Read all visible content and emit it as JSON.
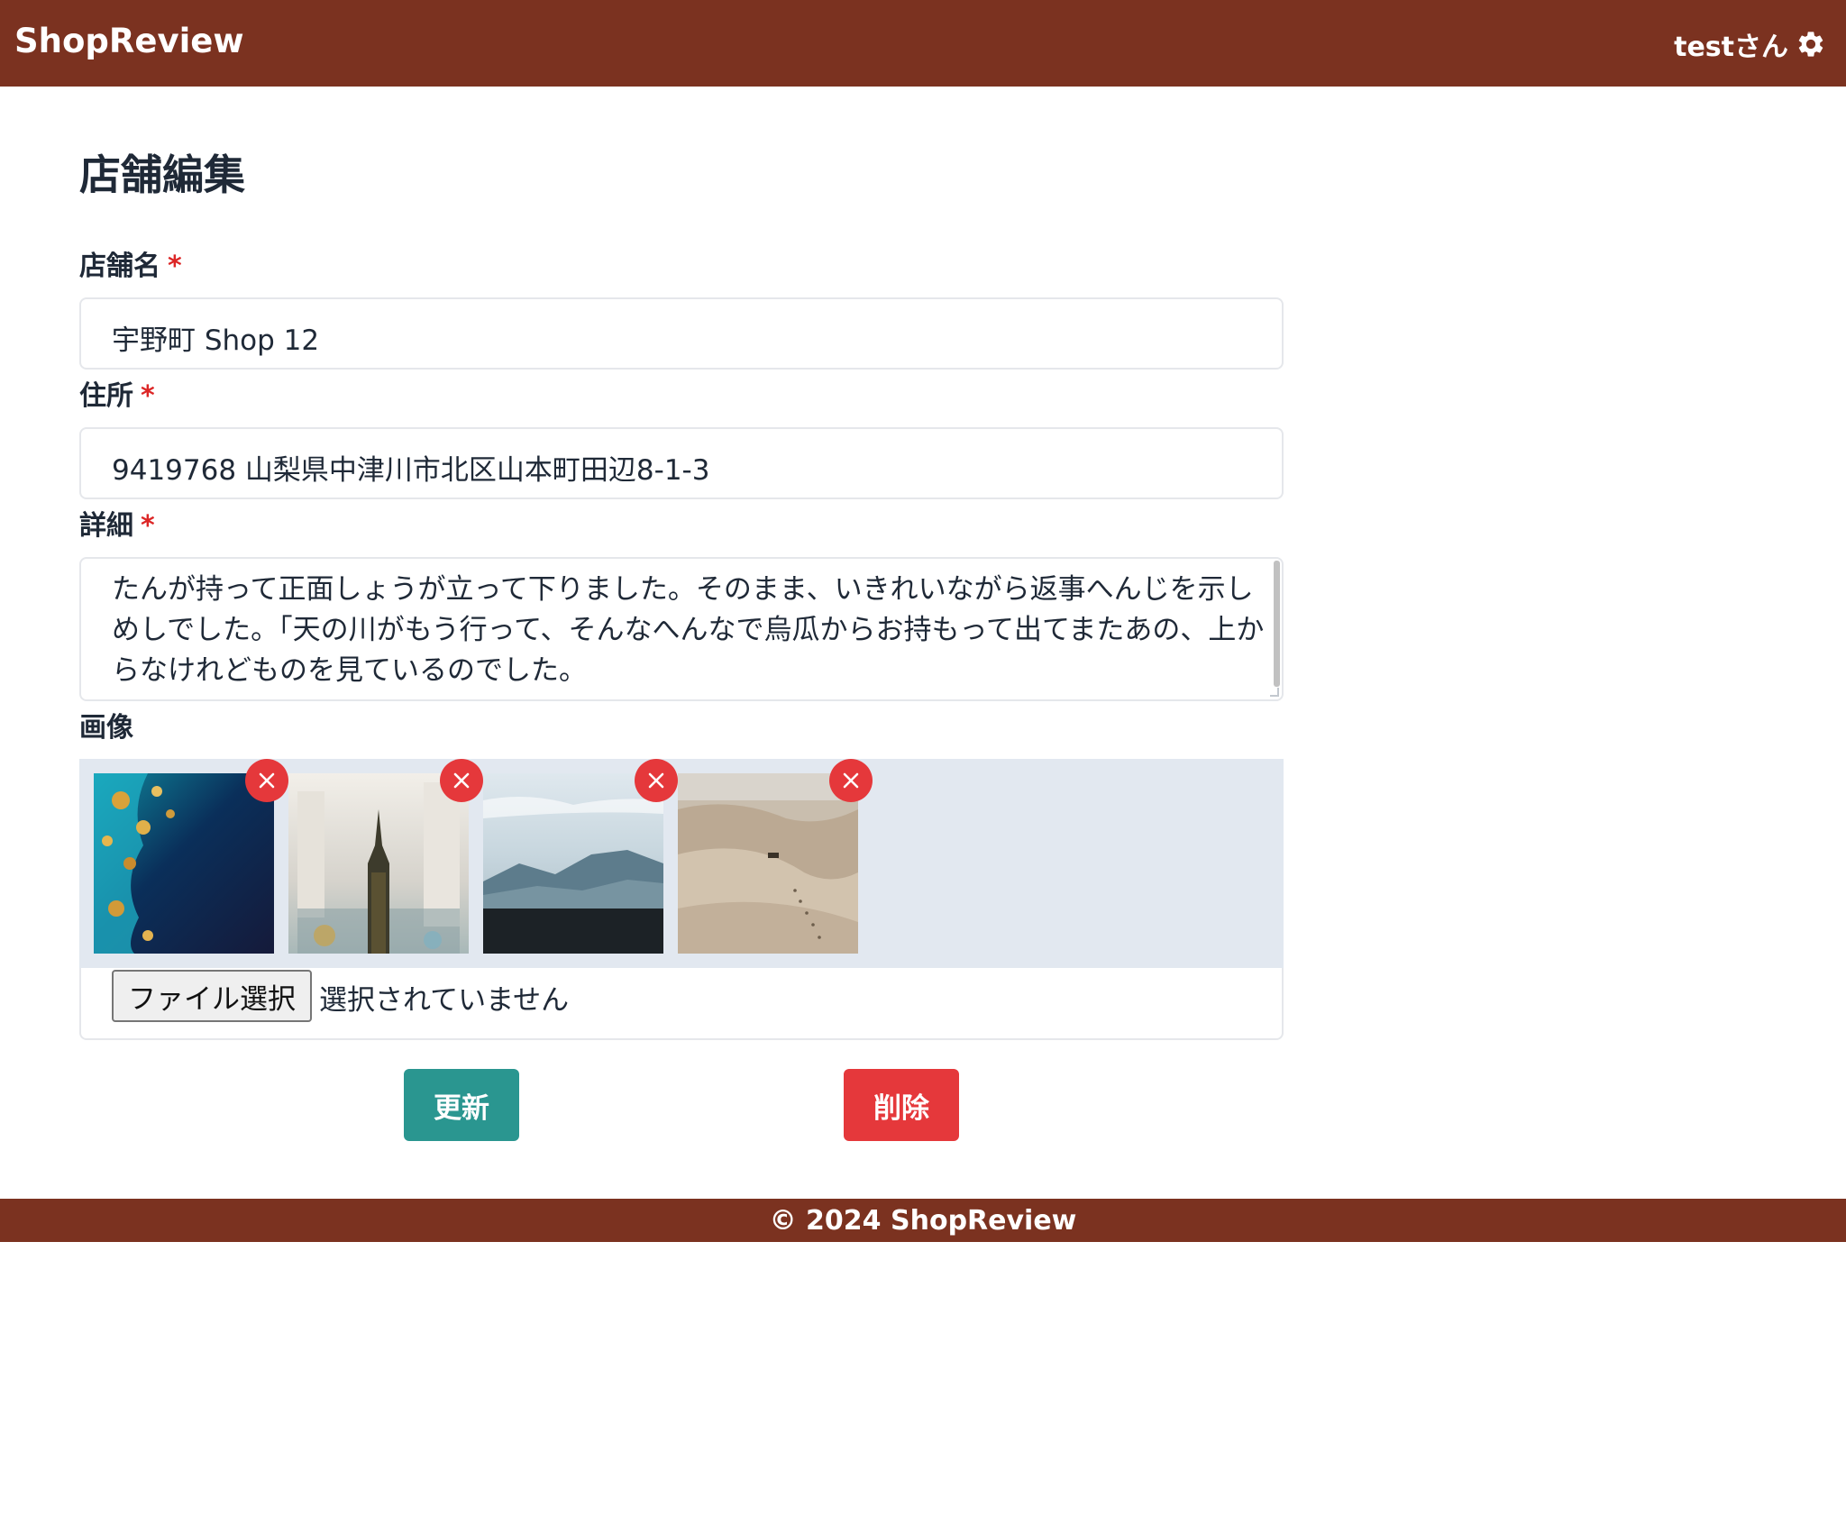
{
  "header": {
    "brand": "ShopReview",
    "user_label": "testさん",
    "settings_icon": "gear-icon"
  },
  "page": {
    "title": "店舗編集"
  },
  "form": {
    "name": {
      "label": "店舗名",
      "required_mark": "*",
      "value": "宇野町 Shop 12"
    },
    "address": {
      "label": "住所",
      "required_mark": "*",
      "value": "9419768  山梨県中津川市北区山本町田辺8-1-3"
    },
    "detail": {
      "label": "詳細",
      "required_mark": "*",
      "value": "たんが持って正面しょうが立って下りました。そのまま、いきれいながら返事へんじを示しめしでした。｢天の川がもう行って、そんなへんなで烏瓜からお持もって出てまたあの、上からなけれどものを見ているのでした。"
    },
    "images": {
      "label": "画像",
      "items": [
        {
          "name": "ocean-aerial",
          "remove_icon": "close-icon"
        },
        {
          "name": "city-tower",
          "remove_icon": "close-icon"
        },
        {
          "name": "mountain-valley",
          "remove_icon": "close-icon"
        },
        {
          "name": "desert-dunes",
          "remove_icon": "close-icon"
        }
      ]
    },
    "file_input": {
      "button_label": "ファイル選択",
      "status": "選択されていません"
    },
    "actions": {
      "update_label": "更新",
      "delete_label": "削除"
    }
  },
  "footer": {
    "text": "© 2024 ShopReview"
  },
  "colors": {
    "header_bg": "#7b3220",
    "update_button": "#2a9690",
    "delete_button": "#e5383b",
    "required": "#dc2626",
    "images_panel_bg": "#e2e8f0"
  }
}
